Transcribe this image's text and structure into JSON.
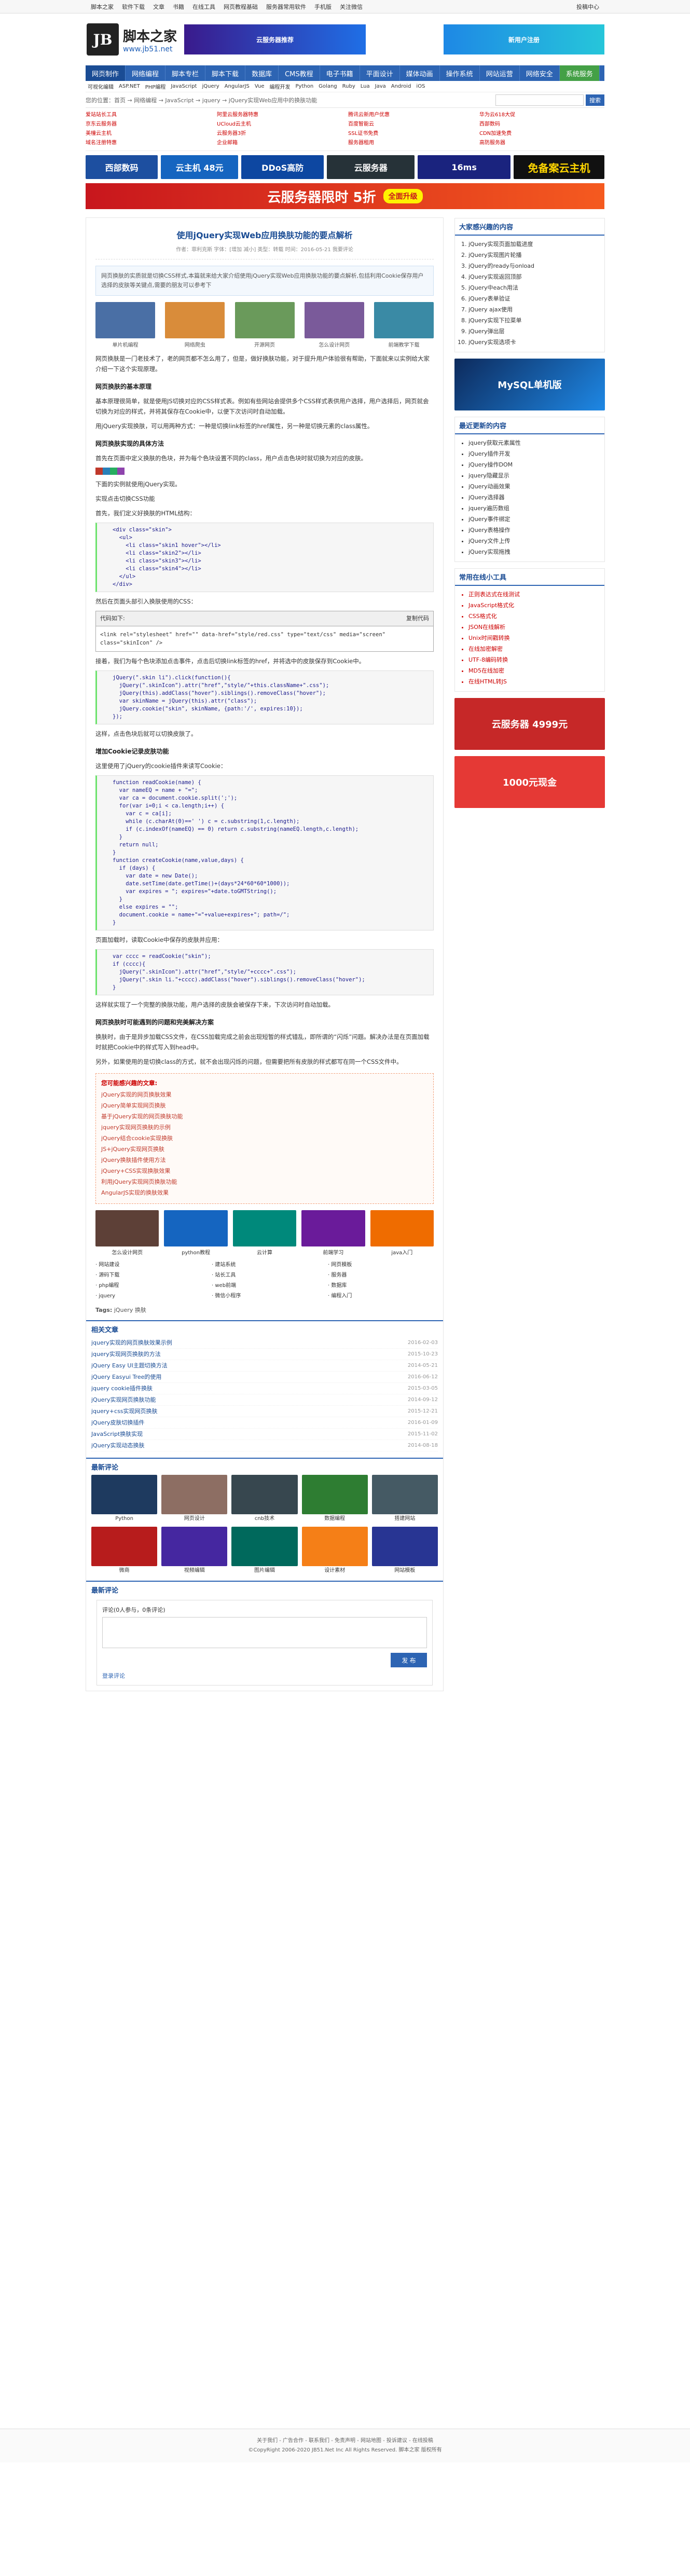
{
  "topbar": {
    "links": [
      "脚本之家",
      "软件下载",
      "文章",
      "书籍",
      "在线工具",
      "网页教程基础",
      "服务器常用软件",
      "手机版",
      "关注微信"
    ],
    "right": "投稿中心"
  },
  "site": {
    "logo_mark": "JB",
    "name": "脚本之家",
    "url": "www.jb51.net",
    "ad1": "云服务器推荐",
    "ad2": "新用户注册"
  },
  "nav": [
    "网页制作",
    "网络编程",
    "脚本专栏",
    "脚本下载",
    "数据库",
    "CMS教程",
    "电子书籍",
    "平面设计",
    "媒体动画",
    "操作系统",
    "网站运营",
    "网络安全",
    "系统服务"
  ],
  "subnav": [
    "可视化编辑",
    "ASP.NET",
    "PHP编程",
    "JavaScript",
    "jQuery",
    "AngularJS",
    "Vue",
    "编程开发",
    "Python",
    "Golang",
    "Ruby",
    "Lua",
    "Java",
    "Android",
    "iOS"
  ],
  "crumbs": "您的位置：首页 → 网络编程 → JavaScript → jquery → jQuery实现Web应用中的换肤功能",
  "search": {
    "placeholder": "",
    "button": "搜索"
  },
  "adlinks": [
    "爱站站长工具",
    "阿里云服务器特惠",
    "腾讯云新用户优惠",
    "华为云618大促",
    "京东云服务器",
    "UCloud云主机",
    "百度智能云",
    "西部数码",
    "美橦云主机",
    "云服务器3折",
    "SSL证书免费",
    "CDN加速免费",
    "域名注册特惠",
    "企业邮箱",
    "服务器租用",
    "高防服务器"
  ],
  "ads": {
    "a1": "西部数码",
    "a2": "云主机 48元",
    "a3": "DDoS高防",
    "a4": "云服务器",
    "a5": "16ms",
    "a6": "免备案云主机",
    "big": "云服务器限时 5折",
    "big_sub": "全面升级"
  },
  "article": {
    "title": "使用jQuery实现Web应用换肤功能的要点解析",
    "meta": "作者：菲利克斯  字体：[增加 减小]  类型：转载  时间：2016-05-21  我要评论",
    "summary": "网页换肤的实质就是切换CSS样式,本篇就来给大家介绍使用jQuery实现Web应用换肤功能的要点解析,包括利用Cookie保存用户选择的皮肤等关键点,需要的朋友可以参考下",
    "thumbs": [
      "单片机编程",
      "网络爬虫",
      "开源网页",
      "怎么设计网页",
      "前端教学下载"
    ],
    "p1": "网页换肤是一门老技术了，老的网页都不怎么用了，但是，做好换肤功能，对于提升用户体验很有帮助，下面就来以实例给大家介绍一下这个实现原理。",
    "h1": "网页换肤的基本原理",
    "p2": "基本原理很简单，就是使用JS切换对应的CSS样式表。例如有些网站会提供多个CSS样式表供用户选择，用户选择后，网页就会切换为对应的样式，并将其保存在Cookie中，以便下次访问时自动加载。",
    "p3": "用jQuery实现换肤，可以用两种方式：一种是切换link标签的href属性，另一种是切换元素的class属性。",
    "h2": "网页换肤实现的具体方法",
    "p4": "首先在页面中定义换肤的色块，并为每个色块设置不同的class，用户点击色块时就切换为对应的皮肤。",
    "p5": "下面的实例就使用jQuery实现。",
    "p6": "实现点击切换CSS功能",
    "p7": "首先，我们定义好换肤的HTML结构：",
    "code1": "<div class=\"skin\">\n  <ul>\n    <li class=\"skin1 hover\"></li>\n    <li class=\"skin2\"></li>\n    <li class=\"skin3\"></li>\n    <li class=\"skin4\"></li>\n  </ul>\n</div>",
    "p8": "然后在页面头部引入换肤使用的CSS：",
    "codebox_title": "代码如下:",
    "codebox_copy": "复制代码",
    "codebox_body": "<link rel=\"stylesheet\" href=\"\" data-href=\"style/red.css\" type=\"text/css\" media=\"screen\" class=\"skinIcon\" />",
    "p9": "接着，我们为每个色块添加点击事件，点击后切换link标签的href，并将选中的皮肤保存到Cookie中。",
    "code2": "jQuery(\".skin li\").click(function(){\n  jQuery(\".skinIcon\").attr(\"href\",\"style/\"+this.className+\".css\");\n  jQuery(this).addClass(\"hover\").siblings().removeClass(\"hover\");\n  var skinName = jQuery(this).attr(\"class\");\n  jQuery.cookie(\"skin\", skinName, {path:'/', expires:10});\n});",
    "p10": "这样，点击色块后就可以切换皮肤了。",
    "h3": "增加Cookie记录皮肤功能",
    "p11": "这里使用了jQuery的cookie插件来读写Cookie：",
    "code3": "function readCookie(name) {\n  var nameEQ = name + \"=\";\n  var ca = document.cookie.split(';');\n  for(var i=0;i < ca.length;i++) {\n    var c = ca[i];\n    while (c.charAt(0)==' ') c = c.substring(1,c.length);\n    if (c.indexOf(nameEQ) == 0) return c.substring(nameEQ.length,c.length);\n  }\n  return null;\n}\nfunction createCookie(name,value,days) {\n  if (days) {\n    var date = new Date();\n    date.setTime(date.getTime()+(days*24*60*60*1000));\n    var expires = \"; expires=\"+date.toGMTString();\n  }\n  else expires = \"\";\n  document.cookie = name+\"=\"+value+expires+\"; path=/\";\n}",
    "p12": "页面加载时，读取Cookie中保存的皮肤并应用：",
    "code4": "var cccc = readCookie(\"skin\");\nif (cccc){\n  jQuery(\".skinIcon\").attr(\"href\",\"style/\"+cccc+\".css\");\n  jQuery(\".skin li.\"+cccc).addClass(\"hover\").siblings().removeClass(\"hover\");\n}",
    "p13": "这样就实现了一个完整的换肤功能，用户选择的皮肤会被保存下来，下次访问时自动加载。",
    "h4": "网页换肤时可能遇到的问题和完美解决方案",
    "p14": "换肤时，由于是异步加载CSS文件，在CSS加载完成之前会出现短暂的样式错乱，即所谓的“闪烁”问题。解决办法是在页面加载时就把Cookie中的样式写入到head中。",
    "p15": "另外，如果使用的是切换class的方式，就不会出现闪烁的问题，但需要把所有皮肤的样式都写在同一个CSS文件中。",
    "related_hd": "您可能感兴趣的文章:",
    "related": [
      "jQuery实现的网页换肤效果",
      "jQuery简单实现网页换肤",
      "基于jQuery实现的网页换肤功能",
      "jquery实现网页换肤的示例",
      "jQuery结合cookie实现换肤",
      "JS+jQuery实现网页换肤",
      "jQuery换肤插件使用方法",
      "jQuery+CSS实现换肤效果",
      "利用jQuery实现网页换肤功能",
      "AngularJS实现的换肤效果"
    ],
    "rel_thumbs": [
      "怎么设计网页",
      "python教程",
      "云计算",
      "前端学习",
      "java入门"
    ],
    "link3": [
      "网站建设",
      "建站系统",
      "网页模板",
      "源码下载",
      "站长工具",
      "服务器",
      "php编程",
      "web前端",
      "数据库",
      "jquery",
      "微信小程序",
      "编程入门"
    ],
    "tags_label": "Tags:",
    "tags": "jQuery  换肤"
  },
  "related_sect": {
    "title": "相关文章",
    "items": [
      [
        "jquery实现的网页换肤效果示例",
        "2016-02-03"
      ],
      [
        "jquery实现网页换肤的方法",
        "2015-10-23"
      ],
      [
        "jQuery Easy UI主题切换方法",
        "2014-05-21"
      ],
      [
        "jQuery Easyui Tree的使用",
        "2016-06-12"
      ],
      [
        "jquery cookie插件换肤",
        "2015-03-05"
      ],
      [
        "jQuery实现网页换肤功能",
        "2014-09-12"
      ],
      [
        "jquery+css实现网页换肤",
        "2015-12-21"
      ],
      [
        "jQuery皮肤切换插件",
        "2016-01-09"
      ],
      [
        "JavaScript换肤实现",
        "2015-11-02"
      ],
      [
        "jQuery实现动态换肤",
        "2014-08-18"
      ]
    ]
  },
  "hot_sect": {
    "title": "最新评论",
    "items": [
      "Python",
      "网页设计",
      "cnb技术",
      "数据编程",
      "搭建网站",
      "微商",
      "视频编辑",
      "图片编辑",
      "设计素材",
      "网站模板"
    ]
  },
  "comment": {
    "title": "最新评论",
    "label": "评论(0人参与，0条评论)",
    "button": "发 布",
    "login": "登录评论"
  },
  "side": {
    "s1_title": "大家感兴趣的内容",
    "s1": [
      "jQuery实现页面加载进度",
      "jQuery实现图片轮播",
      "jQuery的ready与onload",
      "jQuery实现返回顶部",
      "jQuery中each用法",
      "jQuery表单验证",
      "jQuery ajax使用",
      "jQuery实现下拉菜单",
      "jQuery弹出层",
      "jQuery实现选项卡"
    ],
    "s2_title": "最近更新的内容",
    "s2": [
      "jquery获取元素属性",
      "jQuery插件开发",
      "jQuery操作DOM",
      "jquery隐藏显示",
      "jQuery动画效果",
      "jQuery选择器",
      "jquery遍历数组",
      "jQuery事件绑定",
      "jQuery表格操作",
      "jQuery文件上传",
      "jQuery实现拖拽"
    ],
    "s3_title": "常用在线小工具",
    "s3": [
      "正则表达式在线测试",
      "JavaScript格式化",
      "CSS格式化",
      "JSON在线解析",
      "Unix时间戳转换",
      "在线加密解密",
      "UTF-8编码转换",
      "MD5在线加密",
      "在线HTML转JS"
    ],
    "ad1": "MySQL单机版",
    "ad2": "云服务器 4999元",
    "ad3": "1000元现金"
  },
  "footer": {
    "links": "关于我们 - 广告合作 - 联系我们 - 免责声明 - 网站地图 - 投诉建议 - 在线投稿",
    "copy": "©CopyRight 2006-2020 JB51.Net Inc All Rights Reserved. 脚本之家 版权所有"
  },
  "colors": {
    "primary": "#2d64b3",
    "accent": "#c00"
  }
}
